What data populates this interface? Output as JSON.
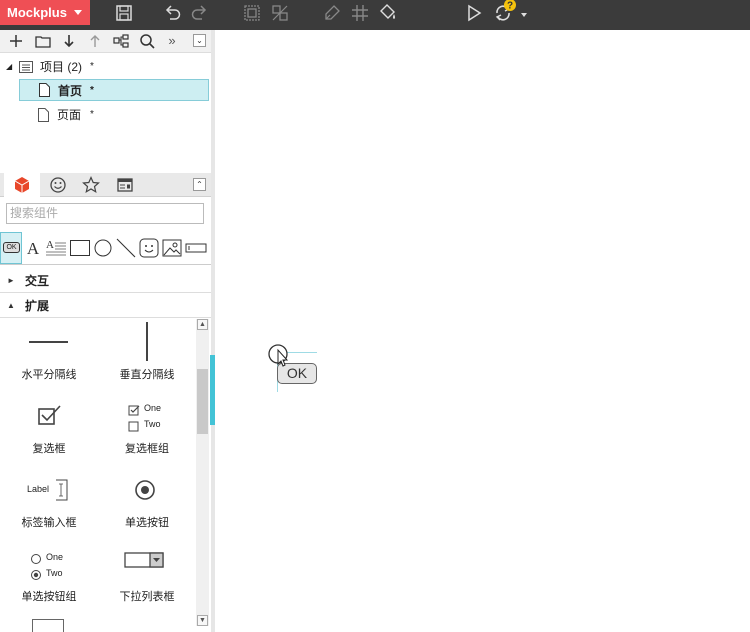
{
  "app": {
    "brand": "Mockplus"
  },
  "toolbar": {
    "icons": [
      "save-icon",
      "undo-icon",
      "redo-icon",
      "group-icon",
      "ungroup-icon",
      "format-painter-icon",
      "grid-icon",
      "fill-icon",
      "preview-play-icon",
      "sync-icon",
      "help-badge-icon"
    ],
    "help_badge": "?"
  },
  "project_panel": {
    "tools": [
      "add-icon",
      "folder-icon",
      "move-down-icon",
      "move-up-icon",
      "sitemap-icon",
      "search-icon",
      "more-icon",
      "collapse-icon"
    ],
    "more_label": "»",
    "tree": [
      {
        "label": "项目 (2)",
        "star": "*",
        "type": "project"
      },
      {
        "label": "首页",
        "star": "*",
        "type": "page",
        "selected": true
      },
      {
        "label": "页面",
        "star": "*",
        "type": "page"
      }
    ]
  },
  "component_panel": {
    "tabs": [
      "components-tab",
      "icons-tab",
      "favorites-tab",
      "templates-tab"
    ],
    "search_placeholder": "搜索组件",
    "quick_items": [
      "button-ok",
      "text",
      "paragraph",
      "rectangle",
      "circle",
      "line",
      "emoji",
      "image",
      "input"
    ],
    "quick_button_label": "OK",
    "sections": [
      {
        "label": "交互",
        "expanded": false
      },
      {
        "label": "扩展",
        "expanded": true
      }
    ],
    "items": [
      {
        "label": "水平分隔线",
        "icon": "hr-icon"
      },
      {
        "label": "垂直分隔线",
        "icon": "vr-icon"
      },
      {
        "label": "复选框",
        "icon": "checkbox-icon"
      },
      {
        "label": "复选框组",
        "icon": "checkbox-group-icon",
        "options": [
          "One",
          "Two"
        ]
      },
      {
        "label": "标签输入框",
        "icon": "label-input-icon",
        "inner": "Label"
      },
      {
        "label": "单选按钮",
        "icon": "radio-icon"
      },
      {
        "label": "单选按钮组",
        "icon": "radio-group-icon",
        "options": [
          "One",
          "Two"
        ]
      },
      {
        "label": "下拉列表框",
        "icon": "dropdown-icon"
      }
    ]
  },
  "canvas": {
    "dragging_label": "OK"
  },
  "colors": {
    "brand": "#ef4f55",
    "accent": "#43c3d6",
    "toolbar": "#3b3b3b"
  }
}
